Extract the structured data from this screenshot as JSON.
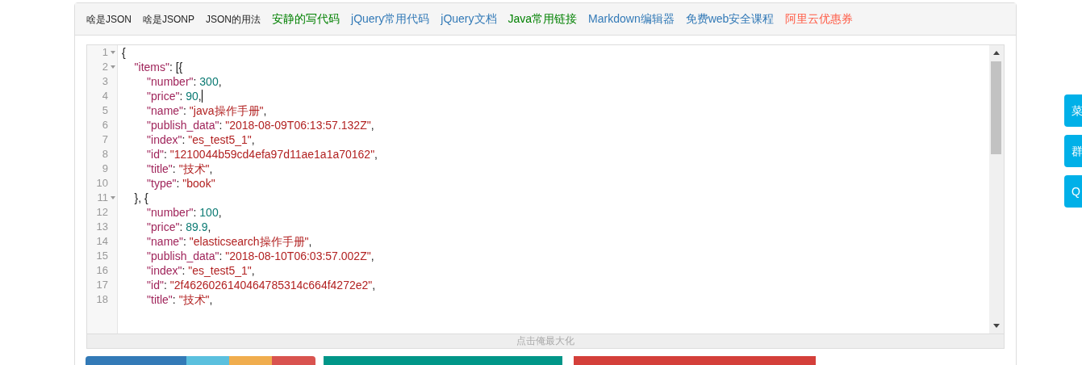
{
  "nav_links": [
    {
      "label": "啥是JSON",
      "kind": "small"
    },
    {
      "label": "啥是JSONP",
      "kind": "small"
    },
    {
      "label": "JSON的用法",
      "kind": "small"
    },
    {
      "label": "安静的写代码",
      "kind": "green"
    },
    {
      "label": "jQuery常用代码",
      "kind": "blue"
    },
    {
      "label": "jQuery文档",
      "kind": "blue"
    },
    {
      "label": "Java常用链接",
      "kind": "green"
    },
    {
      "label": "Markdown编辑器",
      "kind": "blue"
    },
    {
      "label": "免费web安全课程",
      "kind": "blue"
    },
    {
      "label": "阿里云优惠券",
      "kind": "red"
    }
  ],
  "editor": {
    "lines": [
      {
        "number": "1",
        "fold": true,
        "tokens": [
          {
            "kind": "punct",
            "text": "{"
          }
        ]
      },
      {
        "number": "2",
        "fold": true,
        "tokens": [
          {
            "kind": "key",
            "text": "    \"items\""
          },
          {
            "kind": "punct",
            "text": ": [{"
          }
        ]
      },
      {
        "number": "3",
        "fold": false,
        "tokens": [
          {
            "kind": "key",
            "text": "        \"number\""
          },
          {
            "kind": "punct",
            "text": ": "
          },
          {
            "kind": "number",
            "text": "300"
          },
          {
            "kind": "punct",
            "text": ","
          }
        ]
      },
      {
        "number": "4",
        "fold": false,
        "cursor": true,
        "tokens": [
          {
            "kind": "key",
            "text": "        \"price\""
          },
          {
            "kind": "punct",
            "text": ": "
          },
          {
            "kind": "number",
            "text": "90"
          },
          {
            "kind": "punct",
            "text": ","
          }
        ]
      },
      {
        "number": "5",
        "fold": false,
        "tokens": [
          {
            "kind": "key",
            "text": "        \"name\""
          },
          {
            "kind": "punct",
            "text": ": "
          },
          {
            "kind": "string",
            "text": "\"java操作手册\""
          },
          {
            "kind": "punct",
            "text": ","
          }
        ]
      },
      {
        "number": "6",
        "fold": false,
        "tokens": [
          {
            "kind": "key",
            "text": "        \"publish_data\""
          },
          {
            "kind": "punct",
            "text": ": "
          },
          {
            "kind": "string",
            "text": "\"2018-08-09T06:13:57.132Z\""
          },
          {
            "kind": "punct",
            "text": ","
          }
        ]
      },
      {
        "number": "7",
        "fold": false,
        "tokens": [
          {
            "kind": "key",
            "text": "        \"index\""
          },
          {
            "kind": "punct",
            "text": ": "
          },
          {
            "kind": "string",
            "text": "\"es_test5_1\""
          },
          {
            "kind": "punct",
            "text": ","
          }
        ]
      },
      {
        "number": "8",
        "fold": false,
        "tokens": [
          {
            "kind": "key",
            "text": "        \"id\""
          },
          {
            "kind": "punct",
            "text": ": "
          },
          {
            "kind": "string",
            "text": "\"1210044b59cd4efa97d11ae1a1a70162\""
          },
          {
            "kind": "punct",
            "text": ","
          }
        ]
      },
      {
        "number": "9",
        "fold": false,
        "tokens": [
          {
            "kind": "key",
            "text": "        \"title\""
          },
          {
            "kind": "punct",
            "text": ": "
          },
          {
            "kind": "string",
            "text": "\"技术\""
          },
          {
            "kind": "punct",
            "text": ","
          }
        ]
      },
      {
        "number": "10",
        "fold": false,
        "tokens": [
          {
            "kind": "key",
            "text": "        \"type\""
          },
          {
            "kind": "punct",
            "text": ": "
          },
          {
            "kind": "string",
            "text": "\"book\""
          }
        ]
      },
      {
        "number": "11",
        "fold": true,
        "tokens": [
          {
            "kind": "punct",
            "text": "    }, {"
          }
        ]
      },
      {
        "number": "12",
        "fold": false,
        "tokens": [
          {
            "kind": "key",
            "text": "        \"number\""
          },
          {
            "kind": "punct",
            "text": ": "
          },
          {
            "kind": "number",
            "text": "100"
          },
          {
            "kind": "punct",
            "text": ","
          }
        ]
      },
      {
        "number": "13",
        "fold": false,
        "tokens": [
          {
            "kind": "key",
            "text": "        \"price\""
          },
          {
            "kind": "punct",
            "text": ": "
          },
          {
            "kind": "number",
            "text": "89.9"
          },
          {
            "kind": "punct",
            "text": ","
          }
        ]
      },
      {
        "number": "14",
        "fold": false,
        "tokens": [
          {
            "kind": "key",
            "text": "        \"name\""
          },
          {
            "kind": "punct",
            "text": ": "
          },
          {
            "kind": "string",
            "text": "\"elasticsearch操作手册\""
          },
          {
            "kind": "punct",
            "text": ","
          }
        ]
      },
      {
        "number": "15",
        "fold": false,
        "tokens": [
          {
            "kind": "key",
            "text": "        \"publish_data\""
          },
          {
            "kind": "punct",
            "text": ": "
          },
          {
            "kind": "string",
            "text": "\"2018-08-10T06:03:57.002Z\""
          },
          {
            "kind": "punct",
            "text": ","
          }
        ]
      },
      {
        "number": "16",
        "fold": false,
        "tokens": [
          {
            "kind": "key",
            "text": "        \"index\""
          },
          {
            "kind": "punct",
            "text": ": "
          },
          {
            "kind": "string",
            "text": "\"es_test5_1\""
          },
          {
            "kind": "punct",
            "text": ","
          }
        ]
      },
      {
        "number": "17",
        "fold": false,
        "tokens": [
          {
            "kind": "key",
            "text": "        \"id\""
          },
          {
            "kind": "punct",
            "text": ": "
          },
          {
            "kind": "string",
            "text": "\"2f4626026140464785314c664f4272e2\""
          },
          {
            "kind": "punct",
            "text": ","
          }
        ]
      },
      {
        "number": "18",
        "fold": false,
        "tokens": [
          {
            "kind": "key",
            "text": "        \"title\""
          },
          {
            "kind": "punct",
            "text": ": "
          },
          {
            "kind": "string",
            "text": "\"技术\""
          },
          {
            "kind": "punct",
            "text": ","
          }
        ]
      }
    ],
    "maximize_hint": "点击俺最大化"
  },
  "side_buttons": [
    {
      "label": "菜"
    },
    {
      "label": "群"
    },
    {
      "label": "Q"
    }
  ]
}
